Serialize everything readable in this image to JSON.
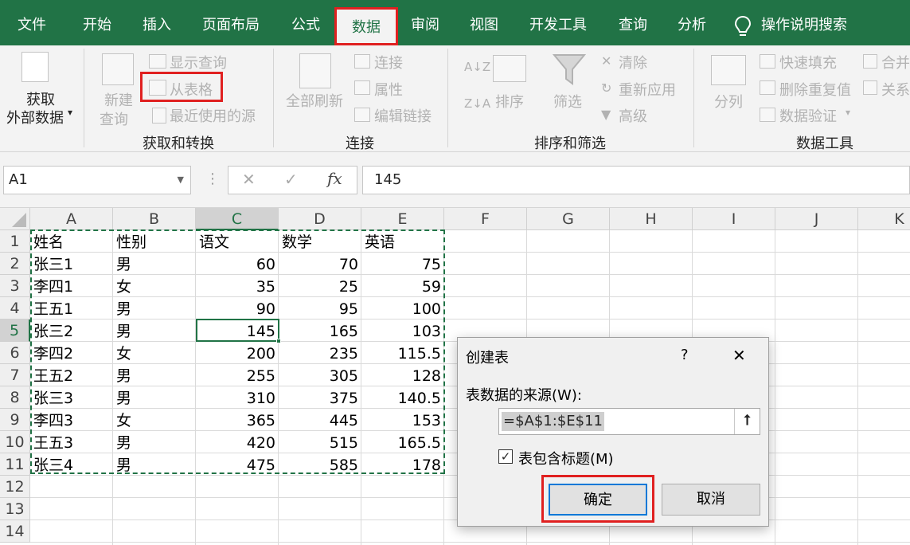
{
  "tabs": [
    "文件",
    "开始",
    "插入",
    "页面布局",
    "公式",
    "数据",
    "审阅",
    "视图",
    "开发工具",
    "查询",
    "分析"
  ],
  "tell_me": "操作说明搜索",
  "ribbon": {
    "external_data": [
      "获取",
      "外部数据"
    ],
    "new_query": [
      "新建",
      "查询"
    ],
    "show_queries": "显示查询",
    "from_table": "从表格",
    "recent_sources": "最近使用的源",
    "group_get_transform": "获取和转换",
    "refresh_all": "全部刷新",
    "connections": "连接",
    "properties": "属性",
    "edit_links": "编辑链接",
    "group_connections": "连接",
    "sort": "排序",
    "filter": "筛选",
    "clear": "清除",
    "reapply": "重新应用",
    "advanced": "高级",
    "group_sort_filter": "排序和筛选",
    "text_to_columns": "分列",
    "flash_fill": "快速填充",
    "remove_duplicates": "删除重复值",
    "data_validation": "数据验证",
    "consolidate": "合并",
    "relationships": "关系",
    "group_data_tools": "数据工具"
  },
  "formula_bar": {
    "name_box": "A1",
    "formula": "145"
  },
  "columns": [
    "A",
    "B",
    "C",
    "D",
    "E",
    "F",
    "G",
    "H",
    "I",
    "J",
    "K"
  ],
  "rows": [
    "1",
    "2",
    "3",
    "4",
    "5",
    "6",
    "7",
    "8",
    "9",
    "10",
    "11",
    "12",
    "13",
    "14"
  ],
  "table": [
    [
      "姓名",
      "性别",
      "语文",
      "数学",
      "英语"
    ],
    [
      "张三1",
      "男",
      "60",
      "70",
      "75"
    ],
    [
      "李四1",
      "女",
      "35",
      "25",
      "59"
    ],
    [
      "王五1",
      "男",
      "90",
      "95",
      "100"
    ],
    [
      "张三2",
      "男",
      "145",
      "165",
      "103"
    ],
    [
      "李四2",
      "女",
      "200",
      "235",
      "115.5"
    ],
    [
      "王五2",
      "男",
      "255",
      "305",
      "128"
    ],
    [
      "张三3",
      "男",
      "310",
      "375",
      "140.5"
    ],
    [
      "李四3",
      "女",
      "365",
      "445",
      "153"
    ],
    [
      "王五3",
      "男",
      "420",
      "515",
      "165.5"
    ],
    [
      "张三4",
      "男",
      "475",
      "585",
      "178"
    ]
  ],
  "dialog": {
    "title": "创建表",
    "help": "?",
    "close": "✕",
    "source_label": "表数据的来源(W):",
    "range": "=$A$1:$E$11",
    "has_headers": "表包含标题(M)",
    "ok": "确定",
    "cancel": "取消"
  },
  "colors": {
    "excel_green": "#217346",
    "highlight_red": "#e02020",
    "selection_dash": "#217346"
  }
}
